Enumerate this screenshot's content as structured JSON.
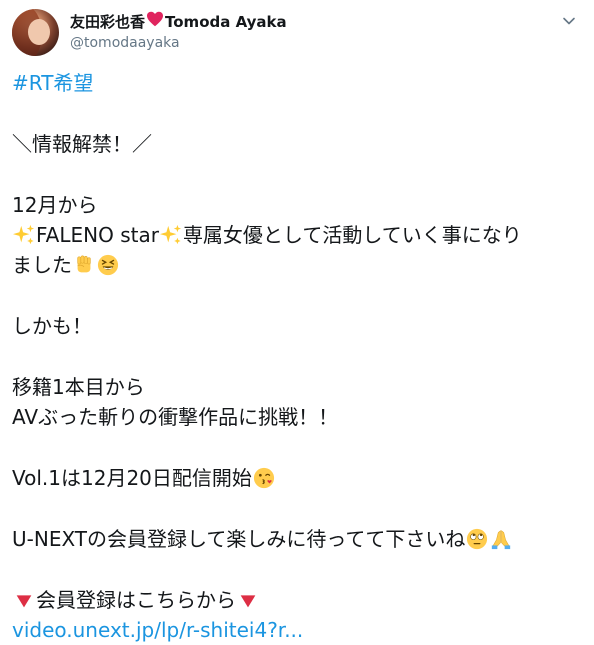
{
  "tweet": {
    "author": {
      "name_part1": "友田彩也香",
      "name_part2": "Tomoda Ayaka",
      "handle": "@tomodaayaka"
    },
    "lines": {
      "hashtag": "#RT希望",
      "announce": "＼情報解禁！／",
      "from_december": "12月から",
      "faleno_brand": "FALENO star",
      "exclusive_text": "専属女優として活動していく事になり",
      "became": "ました",
      "moreover": "しかも！",
      "first_title": "移籍1本目から",
      "av_challenge": "AVぶった斬りの衝撃作品に挑戦！！",
      "vol1": "Vol.1は12月20日配信開始",
      "unext_register": "U-NEXTの会員登録して楽しみに待ってて下さいね",
      "register_here": "会員登録はこちらから",
      "link": "video.unext.jp/lp/r-shitei4?r..."
    },
    "colors": {
      "link": "#1b95e0",
      "text": "#14171a",
      "secondary": "#657786",
      "heart": "#e0245e"
    },
    "icons": [
      "heart-icon",
      "chevron-down-icon",
      "sparkles-icon",
      "raised-fist-icon",
      "grinning-squinting-face-icon",
      "kissing-face-icon",
      "face-with-rolling-eyes-icon",
      "folded-hands-icon",
      "red-triangle-down-icon"
    ]
  }
}
